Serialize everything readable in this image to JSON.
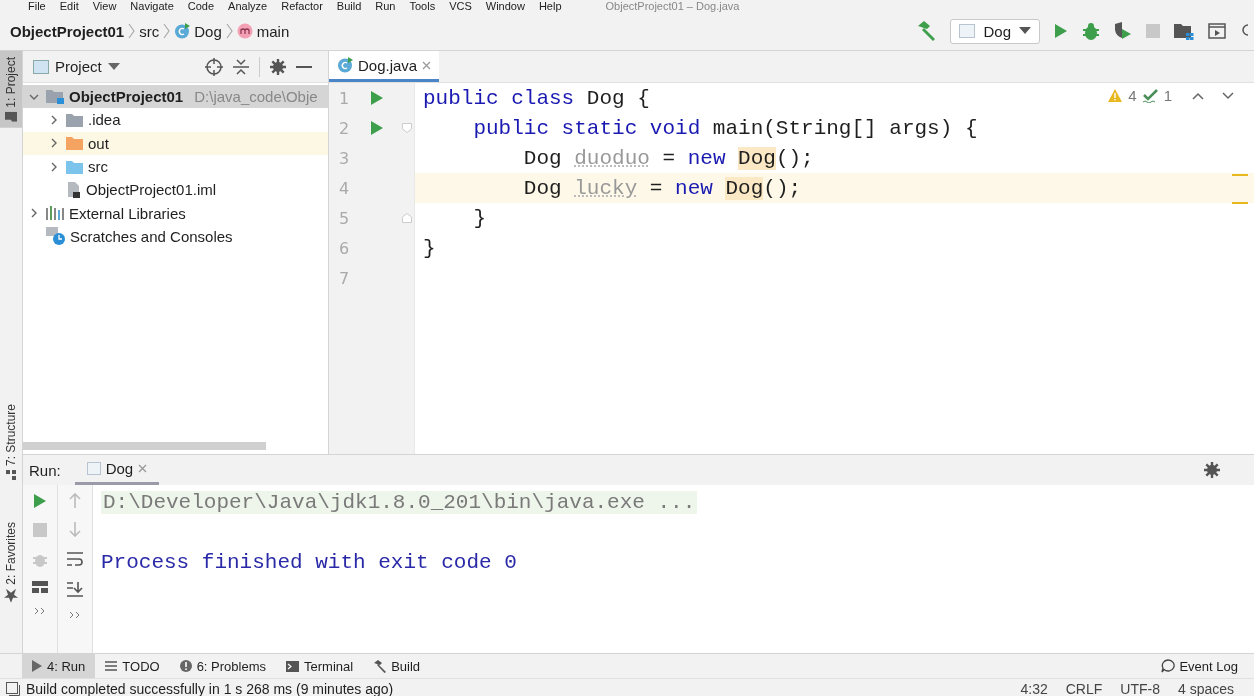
{
  "menu": [
    "File",
    "Edit",
    "View",
    "Navigate",
    "Code",
    "Analyze",
    "Refactor",
    "Build",
    "Run",
    "Tools",
    "VCS",
    "Window",
    "Help"
  ],
  "window": {
    "title": "ObjectProject01 – Dog.java"
  },
  "breadcrumbs": [
    {
      "label": "ObjectProject01",
      "kind": "project"
    },
    {
      "label": "src",
      "kind": "folder"
    },
    {
      "label": "Dog",
      "kind": "class"
    },
    {
      "label": "main",
      "kind": "method"
    }
  ],
  "run_config": {
    "label": "Dog"
  },
  "side_tabs": [
    {
      "label": "1: Project",
      "selected": true,
      "kind": "project"
    },
    {
      "label": "7: Structure",
      "selected": false,
      "kind": "structure"
    },
    {
      "label": "2: Favorites",
      "selected": false,
      "kind": "favorites"
    }
  ],
  "project_panel": {
    "title": "Project",
    "tree": [
      {
        "label": "ObjectProject01",
        "path": "D:\\java_code\\Obje",
        "kind": "module",
        "expanded": true,
        "selected": true,
        "children": [
          {
            "label": ".idea",
            "kind": "folder",
            "color": "#9aa3ad",
            "expanded": false,
            "selected": false
          },
          {
            "label": "out",
            "kind": "folder",
            "color": "#f4a460",
            "expanded": false,
            "selected": false,
            "highlighted": true
          },
          {
            "label": "src",
            "kind": "folder",
            "color": "#7cc4ec",
            "expanded": false,
            "selected": false
          },
          {
            "label": "ObjectProject01.iml",
            "kind": "file",
            "selected": false
          }
        ]
      },
      {
        "label": "External Libraries",
        "kind": "libraries",
        "expanded": false,
        "selected": false
      },
      {
        "label": "Scratches and Consoles",
        "kind": "scratches",
        "selected": false
      }
    ]
  },
  "editor": {
    "tabs": [
      {
        "label": "Dog.java",
        "selected": true
      }
    ],
    "warnings": "4",
    "typos": "1",
    "lines": [
      {
        "number": "1",
        "run": true,
        "fold_start": false,
        "fold_end": false,
        "current": false,
        "tokens": [
          {
            "text": "public class",
            "kind": "keyword"
          },
          {
            "text": " Dog {",
            "kind": "plain"
          }
        ]
      },
      {
        "number": "2",
        "run": true,
        "fold_start": true,
        "fold_end": false,
        "current": false,
        "tokens": [
          {
            "text": "    public static void",
            "kind": "keyword"
          },
          {
            "text": " main(String[] args) {",
            "kind": "plain"
          }
        ]
      },
      {
        "number": "3",
        "run": false,
        "fold_start": false,
        "fold_end": false,
        "current": false,
        "tokens": [
          {
            "text": "        Dog ",
            "kind": "plain"
          },
          {
            "text": "duoduo",
            "kind": "unused"
          },
          {
            "text": " = ",
            "kind": "plain"
          },
          {
            "text": "new ",
            "kind": "keyword"
          },
          {
            "text": "Dog",
            "kind": "highlight"
          },
          {
            "text": "();",
            "kind": "plain"
          }
        ]
      },
      {
        "number": "4",
        "run": false,
        "fold_start": false,
        "fold_end": false,
        "current": true,
        "tokens": [
          {
            "text": "        Dog ",
            "kind": "plain"
          },
          {
            "text": "lucky",
            "kind": "unused"
          },
          {
            "text": " = ",
            "kind": "plain"
          },
          {
            "text": "new ",
            "kind": "keyword"
          },
          {
            "text": "Dog",
            "kind": "highlight"
          },
          {
            "text": "();",
            "kind": "plain"
          }
        ]
      },
      {
        "number": "5",
        "run": false,
        "fold_start": false,
        "fold_end": true,
        "current": false,
        "tokens": [
          {
            "text": "    }",
            "kind": "plain"
          }
        ]
      },
      {
        "number": "6",
        "run": false,
        "fold_start": false,
        "fold_end": false,
        "current": false,
        "tokens": [
          {
            "text": "}",
            "kind": "plain"
          }
        ]
      },
      {
        "number": "7",
        "run": false,
        "fold_start": false,
        "fold_end": false,
        "current": false
      }
    ]
  },
  "run_panel": {
    "label": "Run:",
    "tabs": [
      {
        "label": "Dog",
        "selected": true
      }
    ],
    "output": [
      {
        "text": "D:\\Developer\\Java\\jdk1.8.0_201\\bin\\java.exe ...",
        "kind": "command"
      },
      {
        "text": "Process finished with exit code 0",
        "kind": "system"
      }
    ]
  },
  "tool_tabs": [
    {
      "label": "4: Run",
      "kind": "run",
      "selected": true
    },
    {
      "label": "TODO",
      "kind": "todo",
      "selected": false
    },
    {
      "label": "6: Problems",
      "kind": "problems",
      "selected": false
    },
    {
      "label": "Terminal",
      "kind": "terminal",
      "selected": false
    },
    {
      "label": "Build",
      "kind": "build",
      "selected": false
    }
  ],
  "event_log": "Event Log",
  "status_bar": {
    "message": "Build completed successfully in 1 s 268 ms (9 minutes ago)",
    "position": "4:32",
    "line_separator": "CRLF",
    "encoding": "UTF-8",
    "indent": "4 spaces"
  }
}
